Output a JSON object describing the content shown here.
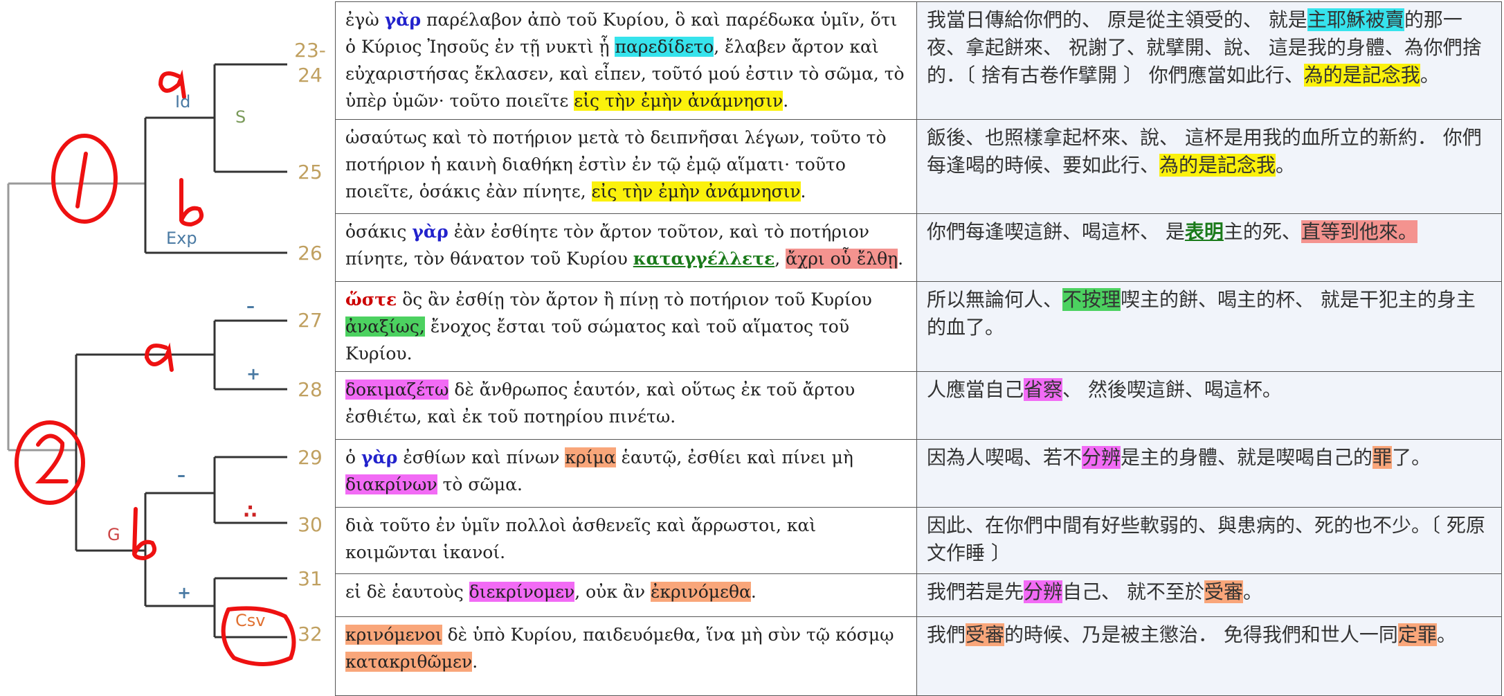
{
  "tree": {
    "verse_numbers": [
      "23-",
      "24",
      "25",
      "26",
      "27",
      "28",
      "29",
      "30",
      "31",
      "32"
    ],
    "labels": {
      "id": "Id",
      "s": "S",
      "exp": "Exp",
      "minus_27": "–",
      "plus_28": "+",
      "minus_29": "–",
      "dots_30": "∴",
      "g": "G",
      "plus_31": "+",
      "csv": "Csv"
    },
    "annotations": {
      "circle_1": "1",
      "circle_2": "2",
      "a_upper": "a",
      "b_upper": "b",
      "a_lower": "a",
      "b_lower": "b"
    }
  },
  "rows": [
    {
      "greek": [
        {
          "t": "ἐγὼ "
        },
        {
          "t": "γὰρ",
          "c": "gar"
        },
        {
          "t": " παρέλαβον ἀπὸ τοῦ Κυρίου, ὃ καὶ παρέδωκα ὑμῖν, ὅτι ὁ Κύριος Ἰησοῦς ἐν τῇ νυκτὶ ᾗ "
        },
        {
          "t": "παρεδίδετο",
          "c": "hl-cyan"
        },
        {
          "t": ", ἔλαβεν ἄρτον καὶ εὐχαριστήσας ἔκλασεν, καὶ εἶπεν, τοῦτό μού ἐστιν τὸ σῶμα, τὸ ὑπὲρ ὑμῶν· τοῦτο ποιεῖτε "
        },
        {
          "t": "εἰς τὴν ἐμὴν ἀνάμνησιν",
          "c": "hl-yellow"
        },
        {
          "t": "."
        }
      ],
      "chinese": [
        {
          "t": "我當日傳給你們的、 原是從主領受的、 就是"
        },
        {
          "t": "主耶穌被賣",
          "c": "hl-cyan"
        },
        {
          "t": "的那一夜、拿起餅來、 祝謝了、就擘開、說、 這是我的身體、為你們捨的．〔 捨有古卷作擘開 〕 你們應當如此行、"
        },
        {
          "t": "為的是記念我",
          "c": "hl-yellow"
        },
        {
          "t": "。"
        }
      ]
    },
    {
      "greek": [
        {
          "t": "ὡσαύτως καὶ τὸ ποτήριον μετὰ τὸ δειπνῆσαι λέγων, τοῦτο τὸ ποτήριον ἡ καινὴ διαθήκη ἐστὶν ἐν τῷ ἐμῷ αἵματι· τοῦτο ποιεῖτε, ὁσάκις ἐὰν πίνητε, "
        },
        {
          "t": "εἰς τὴν ἐμὴν ἀνάμνησιν",
          "c": "hl-yellow"
        },
        {
          "t": "."
        }
      ],
      "chinese": [
        {
          "t": "飯後、也照樣拿起杯來、說、 這杯是用我的血所立的新約． 你們每逢喝的時候、要如此行、"
        },
        {
          "t": "為的是記念我",
          "c": "hl-yellow"
        },
        {
          "t": "。"
        }
      ]
    },
    {
      "greek": [
        {
          "t": "ὁσάκις "
        },
        {
          "t": "γὰρ",
          "c": "gar"
        },
        {
          "t": " ἐὰν ἐσθίητε τὸν ἄρτον τοῦτον, καὶ τὸ ποτήριον πίνητε, τὸν θάνατον τοῦ Κυρίου "
        },
        {
          "t": "καταγγέλλετε",
          "c": "kat"
        },
        {
          "t": ", "
        },
        {
          "t": "ἄχρι οὗ ἔλθῃ",
          "c": "hl-red"
        },
        {
          "t": "."
        }
      ],
      "chinese": [
        {
          "t": "你們每逢喫這餅、喝這杯、 是"
        },
        {
          "t": "表明",
          "c": "kat"
        },
        {
          "t": "主的死、"
        },
        {
          "t": "直等到他來。",
          "c": "hl-red"
        }
      ]
    },
    {
      "greek": [
        {
          "t": "ὥστε",
          "c": "hoste"
        },
        {
          "t": " ὃς ἂν ἐσθίῃ τὸν ἄρτον ἢ πίνῃ τὸ ποτήριον τοῦ Κυρίου "
        },
        {
          "t": "ἀναξίως,",
          "c": "hl-green"
        },
        {
          "t": " ἔνοχος ἔσται τοῦ σώματος καὶ τοῦ αἵματος τοῦ Κυρίου."
        }
      ],
      "chinese": [
        {
          "t": "所以無論何人、"
        },
        {
          "t": "不按理",
          "c": "hl-green"
        },
        {
          "t": "喫主的餅、喝主的杯、 就是干犯主的身主的血了。"
        }
      ]
    },
    {
      "greek": [
        {
          "t": "δοκιμαζέτω",
          "c": "hl-pink"
        },
        {
          "t": " δὲ ἄνθρωπος ἑαυτόν, καὶ οὕτως ἐκ τοῦ ἄρτου ἐσθιέτω, καὶ ἐκ τοῦ ποτηρίου πινέτω."
        }
      ],
      "chinese": [
        {
          "t": "人應當自己"
        },
        {
          "t": "省察",
          "c": "hl-pink"
        },
        {
          "t": "、 然後喫這餅、喝這杯。"
        }
      ]
    },
    {
      "greek": [
        {
          "t": "ὁ "
        },
        {
          "t": "γὰρ",
          "c": "gar"
        },
        {
          "t": " ἐσθίων καὶ πίνων "
        },
        {
          "t": "κρίμα",
          "c": "hl-orange"
        },
        {
          "t": " ἑαυτῷ, ἐσθίει καὶ πίνει μὴ "
        },
        {
          "t": "διακρίνων",
          "c": "hl-pink"
        },
        {
          "t": " τὸ σῶμα."
        }
      ],
      "chinese": [
        {
          "t": "因為人喫喝、若不"
        },
        {
          "t": "分辨",
          "c": "hl-pink"
        },
        {
          "t": "是主的身體、就是喫喝自己的"
        },
        {
          "t": "罪",
          "c": "hl-orange"
        },
        {
          "t": "了。"
        }
      ]
    },
    {
      "greek": [
        {
          "t": "διὰ τοῦτο ἐν ὑμῖν πολλοὶ ἀσθενεῖς καὶ ἄρρωστοι, καὶ κοιμῶνται ἱκανοί."
        }
      ],
      "chinese": [
        {
          "t": "因此、在你們中間有好些軟弱的、與患病的、死的也不少。〔 死原文作睡 〕"
        }
      ]
    },
    {
      "greek": [
        {
          "t": "εἰ δὲ ἑαυτοὺς "
        },
        {
          "t": "διεκρίνομεν",
          "c": "hl-pink"
        },
        {
          "t": ", οὐκ ἂν "
        },
        {
          "t": "ἐκρινόμεθα",
          "c": "hl-orange"
        },
        {
          "t": "."
        }
      ],
      "chinese": [
        {
          "t": "我們若是先"
        },
        {
          "t": "分辨",
          "c": "hl-pink"
        },
        {
          "t": "自己、 就不至於"
        },
        {
          "t": "受審",
          "c": "hl-orange"
        },
        {
          "t": "。"
        }
      ]
    },
    {
      "greek": [
        {
          "t": "κρινόμενοι",
          "c": "hl-orange"
        },
        {
          "t": " δὲ ὑπὸ Κυρίου, παιδευόμεθα, ἵνα μὴ σὺν τῷ κόσμῳ "
        },
        {
          "t": "κατακριθῶμεν",
          "c": "hl-orange"
        },
        {
          "t": "."
        }
      ],
      "chinese": [
        {
          "t": "我們"
        },
        {
          "t": "受審",
          "c": "hl-orange"
        },
        {
          "t": "的時候、乃是被主懲治． 免得我們和世人一同"
        },
        {
          "t": "定罪",
          "c": "hl-orange"
        },
        {
          "t": "。"
        }
      ]
    }
  ]
}
